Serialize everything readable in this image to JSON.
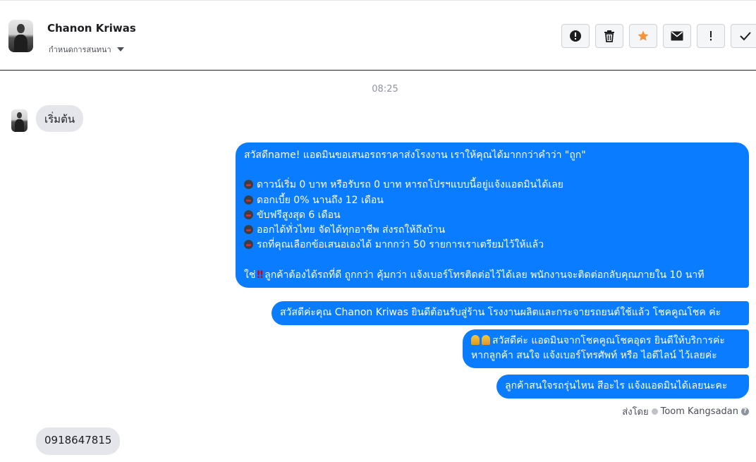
{
  "header": {
    "contact_name": "Chanon Kriwas",
    "assign_label": "กำหนดการสนทนา",
    "actions": [
      {
        "name": "report-icon",
        "symbol": "!"
      },
      {
        "name": "trash-icon",
        "symbol": "trash"
      },
      {
        "name": "star-icon",
        "symbol": "★",
        "color": "#f7923b"
      },
      {
        "name": "mail-icon",
        "symbol": "envelope"
      },
      {
        "name": "priority-icon",
        "symbol": "!"
      },
      {
        "name": "done-icon",
        "symbol": "✓"
      }
    ]
  },
  "conversation": {
    "timestamp": "08:25",
    "incoming_start": "เริ่มต้น",
    "outgoing_1": {
      "line1": "สวัสดีname! แอดมินขอเสนอรถราคาส่งโรงงาน เราให้คุณได้มากกว่าคำว่า \"ถูก\"",
      "bullets": [
        "ดาวน์เริ่ม 0 บาท หรือรับรถ 0 บาท หารถโปรฯแบบนี้อยู่แจ้งแอดมินได้เลย",
        "ดอกเบี้ย 0% นานถึง 12 เดือน",
        "ขับฟรีสูงสุด 6 เดือน",
        "ออกได้ทั่วไทย จัดได้ทุกอาชีพ ส่งรถให้ถึงบ้าน",
        "รถที่คุณเลือกข้อเสนอเองได้ มากกว่า 50 รายการเราเตรียมไว้ให้แล้ว"
      ],
      "closing_prefix": "ใช่",
      "closing_text": "ลูกค้าต้องได้รถที่ดี ถูกกว่า คุ้มกว่า แจ้งเบอร์โทรติดต่อไว้ได้เลย พนักงานจะติดต่อกลับคุณภายใน 10 นาที"
    },
    "outgoing_2": "สวัสดีค่ะคุณ Chanon Kriwas ยินดีต้อนรับสู่ร้าน โรงงานผลิตและกระจายรถยนต์ใช้แล้ว โชคคูณโชค ค่ะ",
    "outgoing_3": {
      "line1": "สวัสดีค่ะ แอดมินจากโชคคูณโชคอุดร ยินดีให้บริการค่ะ",
      "line2": "หากลูกค้า สนใจ แจ้งเบอร์โทรศัพท์ หรือ ไอดีไลน์  ไว้เลยค่ะ"
    },
    "outgoing_4": "ลูกค้าสนใจรถรุ่นไหน สีอะไร แจ้งแอดมินได้เลยนะคะ",
    "sent_by_label": "ส่งโดย",
    "sent_by_name": "Toom Kangsadan",
    "incoming_phone": "0918647815"
  },
  "colors": {
    "outgoing_bubble": "#0a7cff",
    "incoming_bubble": "#e4e6eb",
    "star": "#f7923b"
  }
}
